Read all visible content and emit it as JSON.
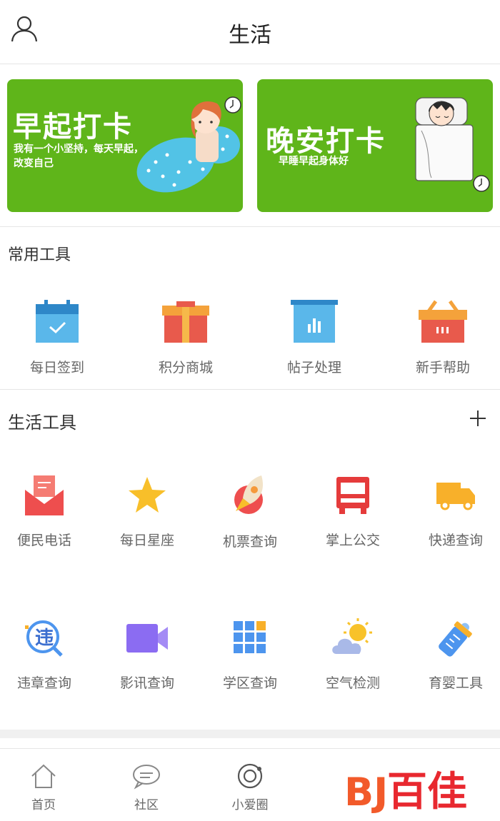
{
  "header": {
    "title": "生活"
  },
  "banners": [
    {
      "title": "早起打卡",
      "subtitle_line1": "我有一个小坚持，每天早起，",
      "subtitle_line2": "改变自己",
      "color": "#5fb51a"
    },
    {
      "title": "晚安打卡",
      "subtitle": "早睡早起身体好",
      "color": "#5fb51a"
    }
  ],
  "common_tools": {
    "title": "常用工具",
    "items": [
      {
        "label": "每日签到",
        "icon": "calendar-check-icon"
      },
      {
        "label": "积分商城",
        "icon": "gift-icon"
      },
      {
        "label": "帖子处理",
        "icon": "chart-board-icon"
      },
      {
        "label": "新手帮助",
        "icon": "basket-icon"
      }
    ]
  },
  "life_tools": {
    "title": "生活工具",
    "row1": [
      {
        "label": "便民电话",
        "icon": "envelope-icon"
      },
      {
        "label": "每日星座",
        "icon": "star-icon"
      },
      {
        "label": "机票查询",
        "icon": "rocket-icon"
      },
      {
        "label": "掌上公交",
        "icon": "bus-icon"
      },
      {
        "label": "快递查询",
        "icon": "truck-icon"
      }
    ],
    "row2": [
      {
        "label": "违章查询",
        "icon": "violation-search-icon",
        "glyph": "违"
      },
      {
        "label": "影讯查询",
        "icon": "video-camera-icon"
      },
      {
        "label": "学区查询",
        "icon": "grid-icon"
      },
      {
        "label": "空气检测",
        "icon": "weather-icon"
      },
      {
        "label": "育婴工具",
        "icon": "baby-bottle-icon"
      }
    ]
  },
  "tabbar": [
    {
      "label": "首页",
      "icon": "home-icon"
    },
    {
      "label": "社区",
      "icon": "chat-icon"
    },
    {
      "label": "小爱圈",
      "icon": "circle-icon"
    }
  ],
  "watermark": {
    "text": "百佳",
    "mark": "BJ"
  }
}
